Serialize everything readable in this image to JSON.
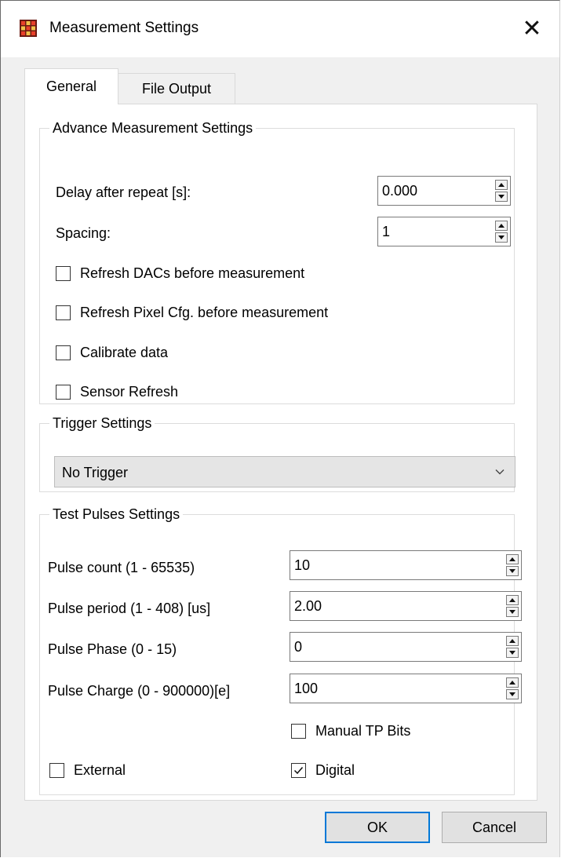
{
  "window": {
    "title": "Measurement Settings",
    "close_glyph": "✕",
    "icon": "grid-app-icon"
  },
  "tabs": [
    {
      "label": "General",
      "active": true
    },
    {
      "label": "File Output",
      "active": false
    }
  ],
  "advance": {
    "title": "Advance Measurement Settings",
    "delay_label": "Delay after repeat [s]:",
    "delay_value": "0.000",
    "spacing_label": "Spacing:",
    "spacing_value": "1",
    "checks": [
      {
        "label": "Refresh DACs before measurement",
        "checked": false
      },
      {
        "label": "Refresh Pixel Cfg. before measurement",
        "checked": false
      },
      {
        "label": "Calibrate data",
        "checked": false
      },
      {
        "label": "Sensor Refresh",
        "checked": false
      }
    ]
  },
  "trigger": {
    "title": "Trigger Settings",
    "selected": "No Trigger"
  },
  "pulses": {
    "title": "Test Pulses Settings",
    "fields": [
      {
        "label": "Pulse count (1 - 65535)",
        "value": "10"
      },
      {
        "label": "Pulse period (1 - 408) [us]",
        "value": "2.00"
      },
      {
        "label": "Pulse Phase (0 - 15)",
        "value": "0"
      },
      {
        "label": "Pulse Charge (0 - 900000)[e]",
        "value": "100"
      }
    ],
    "manual_tp_bits": {
      "label": "Manual TP Bits",
      "checked": false
    },
    "external": {
      "label": "External",
      "checked": false
    },
    "digital": {
      "label": "Digital",
      "checked": true
    }
  },
  "buttons": {
    "ok": "OK",
    "cancel": "Cancel"
  },
  "colors": {
    "accent": "#0078d7",
    "dialog_bg": "#f0f0f0",
    "panel_bg": "#ffffff"
  }
}
